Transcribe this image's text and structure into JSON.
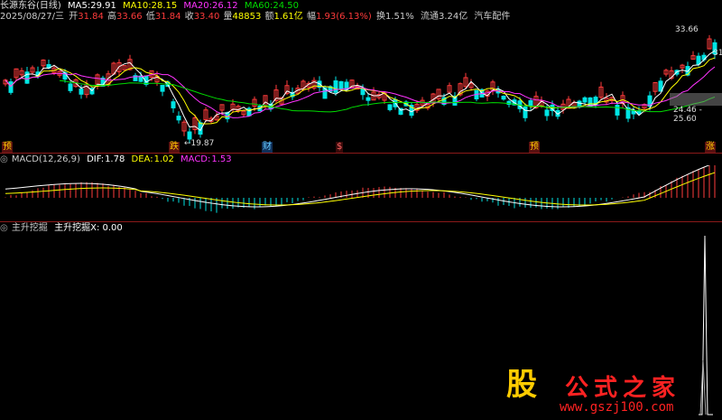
{
  "header": {
    "stock": "长源东谷(日线)",
    "ma5_label": "MA5:",
    "ma5": "29.91",
    "ma10_label": "MA10:",
    "ma10": "28.15",
    "ma20_label": "MA20:",
    "ma20": "26.12",
    "ma60_label": "MA60:",
    "ma60": "24.50"
  },
  "quote": {
    "date": "2025/08/27/三",
    "open_label": "开",
    "open": "31.84",
    "high_label": "高",
    "high": "33.66",
    "low_label": "低",
    "low": "31.84",
    "close_label": "收",
    "close": "33.40",
    "vol_label": "量",
    "vol": "48853",
    "amount_label": "额",
    "amount": "1.61亿",
    "change_label": "幅",
    "change": "1.93(6.13%)",
    "turnover_label": "换",
    "turnover": "1.51%",
    "float_label": "流通",
    "float": "3.24亿",
    "industry": "汽车配件"
  },
  "price_labels": {
    "high_mark": "33.66",
    "low_mark": "←19.87",
    "range": "24.46 - 25.60",
    "right_edge": "31"
  },
  "event_badges": [
    "预",
    "跌",
    "财",
    "$",
    "预",
    "涨"
  ],
  "macd": {
    "title": "MACD(12,26,9)",
    "dif_label": "DIF:",
    "dif": "1.78",
    "dea_label": "DEA:",
    "dea": "1.02",
    "macd_label": "MACD:",
    "macd": "1.53"
  },
  "indicator": {
    "title": "主升挖掘",
    "line": "主升挖掘X: 0.00"
  },
  "watermark": {
    "glyph": "股",
    "title": "公式之家",
    "url": "www.gszj100.com"
  },
  "colors": {
    "up": "#ff3b3b",
    "down": "#00e5e5",
    "ma5": "#ffffff",
    "ma10": "#ffff00",
    "ma20": "#ff33ff",
    "ma60": "#00dd00",
    "separator": "#8b1a1a"
  }
}
